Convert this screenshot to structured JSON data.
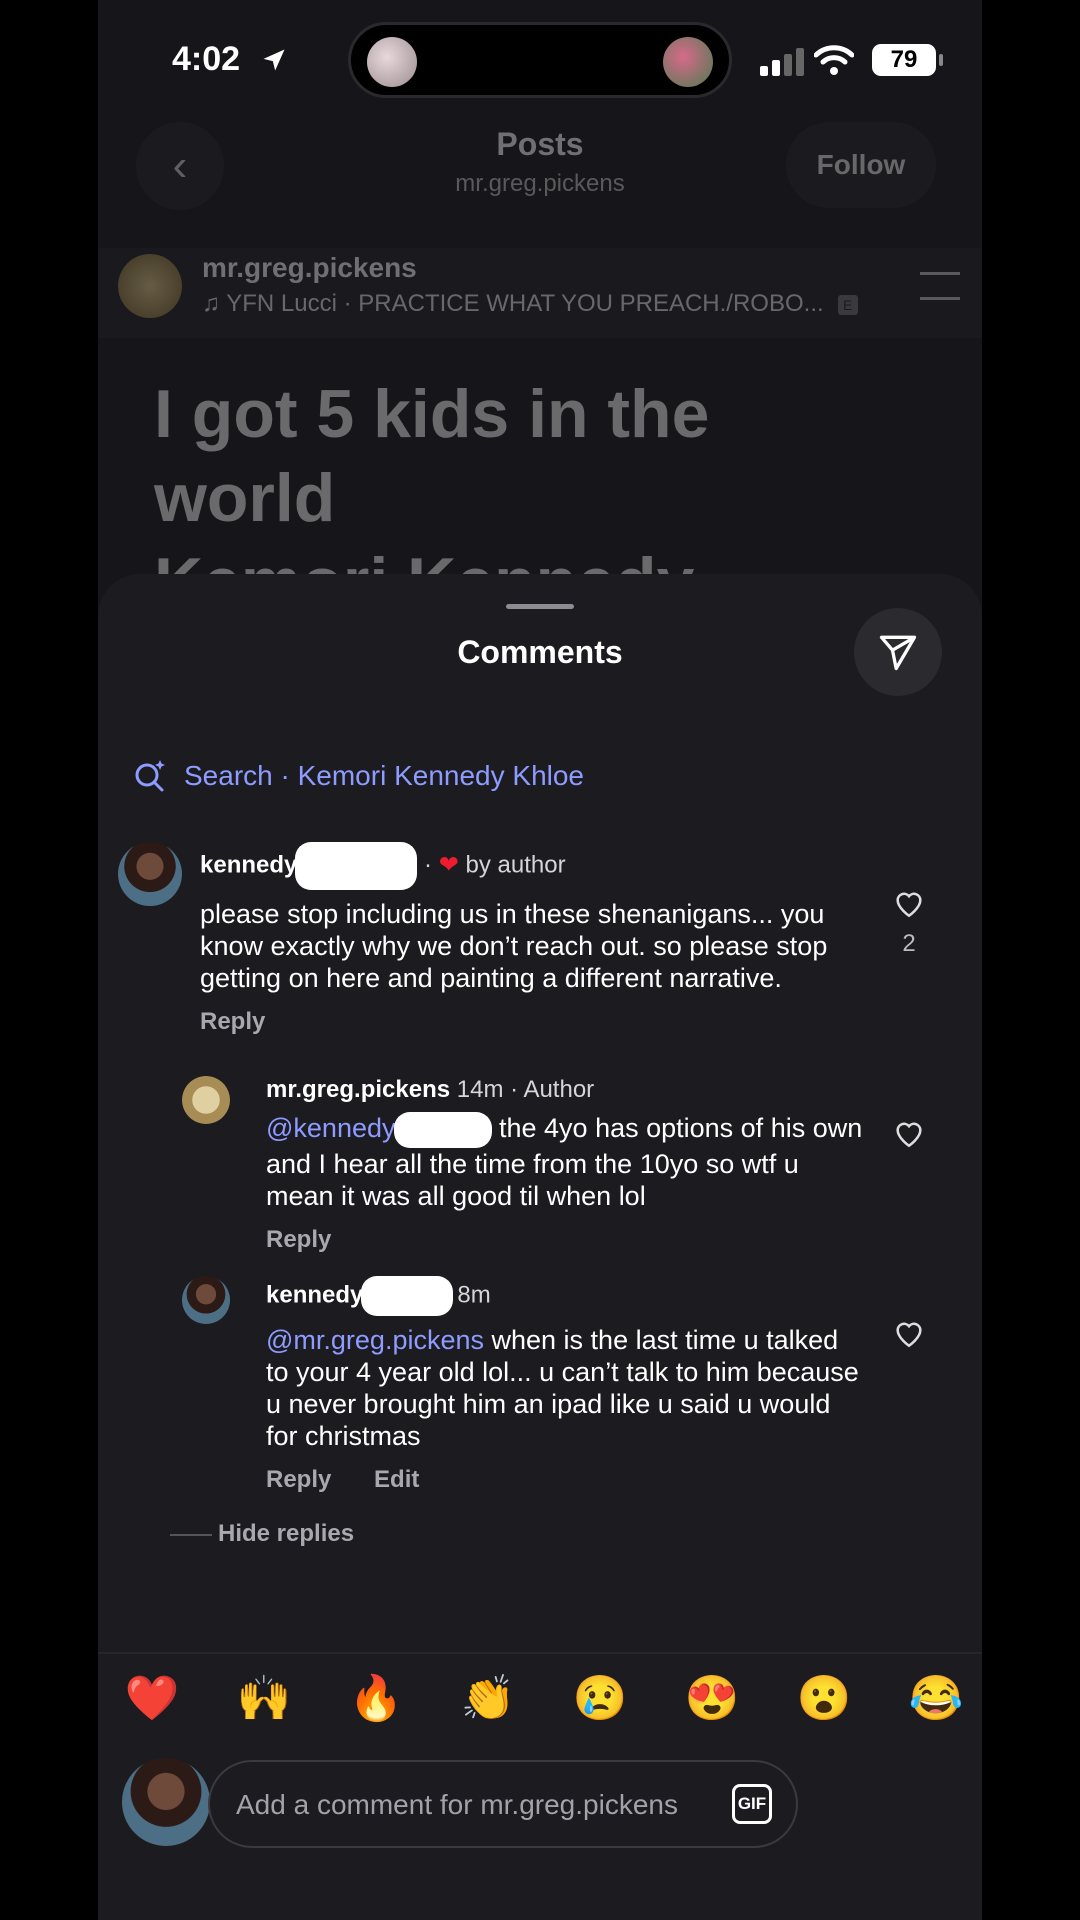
{
  "status_bar": {
    "time": "4:02",
    "battery": "79"
  },
  "header": {
    "title": "Posts",
    "subtitle": "mr.greg.pickens",
    "follow_label": "Follow"
  },
  "post": {
    "username": "mr.greg.pickens",
    "music": "YFN Lucci · PRACTICE WHAT YOU PREACH./ROBO...",
    "explicit": "E",
    "text_line1": "I got 5 kids in the",
    "text_line2": "world",
    "text_line3": "Kemori Kennedy"
  },
  "comments_sheet": {
    "title": "Comments",
    "search_label": "Search",
    "search_query": "· Kemori Kennedy Khloe",
    "comments": [
      {
        "username": "kennedy",
        "meta_sep": "·",
        "liked_by_author": "by author",
        "text": "please stop including us in these shenanigans... you know exactly why we don’t reach out. so please stop getting on here and painting a different narrative.",
        "likes": "2",
        "reply_label": "Reply"
      },
      {
        "username": "mr.greg.pickens",
        "time": "14m",
        "role": "· Author",
        "mention": "@kennedy",
        "text": " the 4yo has options of his own and I hear all the time from the 10yo so wtf u mean it was all good til when lol",
        "reply_label": "Reply"
      },
      {
        "username": "kennedy",
        "time": "8m",
        "mention": "@mr.greg.pickens",
        "text": " when is the last time u talked to your 4 year old lol... u can’t talk to him because u never brought him an ipad like u said u would for christmas",
        "reply_label": "Reply",
        "edit_label": "Edit"
      }
    ],
    "hide_replies": "Hide replies"
  },
  "reactions": [
    "❤️",
    "🙌",
    "🔥",
    "👏",
    "😢",
    "😍",
    "😮",
    "😂"
  ],
  "composer": {
    "placeholder": "Add a comment for mr.greg.pickens",
    "gif_label": "GIF"
  },
  "colors": {
    "accent": "#8e9bff",
    "heart": "#ed1c2e",
    "background": "#1b1b20"
  }
}
